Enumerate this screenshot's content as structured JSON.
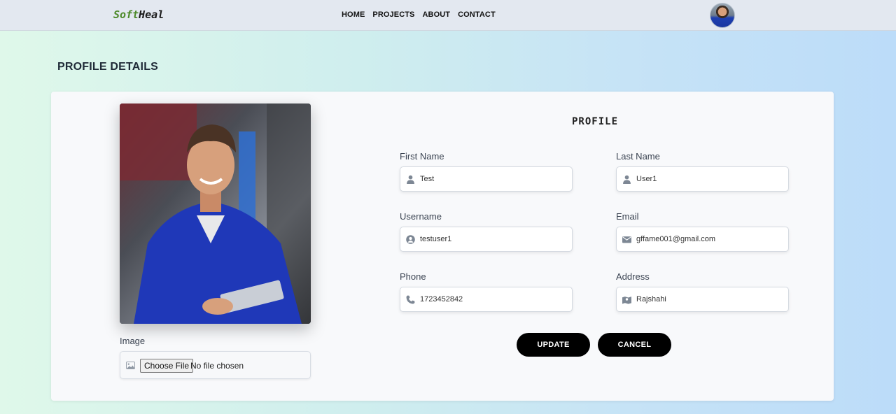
{
  "brand": {
    "part1": "Soft",
    "part2": "Heal"
  },
  "nav": {
    "links": [
      "HOME",
      "PROJECTS",
      "ABOUT",
      "CONTACT"
    ]
  },
  "page": {
    "title": "PROFILE DETAILS"
  },
  "image_section": {
    "label": "Image",
    "choose_label": "Choose File",
    "no_file": "No file chosen"
  },
  "form": {
    "title": "PROFILE",
    "first_name": {
      "label": "First Name",
      "value": "Test",
      "icon": "user-icon"
    },
    "last_name": {
      "label": "Last Name",
      "value": "User1",
      "icon": "user-icon"
    },
    "username": {
      "label": "Username",
      "value": "testuser1",
      "icon": "user-circle-icon"
    },
    "email": {
      "label": "Email",
      "value": "gffame001@gmail.com",
      "icon": "envelope-icon"
    },
    "phone": {
      "label": "Phone",
      "value": "1723452842",
      "icon": "phone-icon"
    },
    "address": {
      "label": "Address",
      "value": "Rajshahi",
      "icon": "map-icon"
    }
  },
  "buttons": {
    "update": "UPDATE",
    "cancel": "CANCEL"
  },
  "colors": {
    "brand_green": "#4d8a2a",
    "button_bg": "#000000",
    "card_bg": "#f8f9fb"
  }
}
